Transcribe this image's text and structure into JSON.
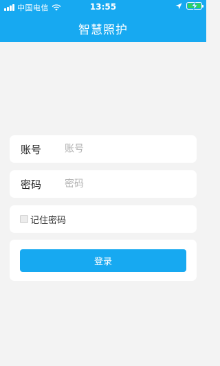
{
  "status_bar": {
    "carrier": "中国电信",
    "time": "13:55",
    "icons": [
      "signal-icon",
      "wifi-icon",
      "location-icon",
      "battery-charging-icon"
    ]
  },
  "header": {
    "title": "智慧照护",
    "color": "#17a9f1"
  },
  "form": {
    "account_label": "账号",
    "account_placeholder": "账号",
    "account_value": "",
    "password_label": "密码",
    "password_placeholder": "密码",
    "password_value": "",
    "remember_label": "记住密码",
    "remember_checked": false,
    "login_label": "登录"
  },
  "colors": {
    "accent": "#17a9f1",
    "background": "#f3f3f3",
    "card": "#ffffff"
  }
}
